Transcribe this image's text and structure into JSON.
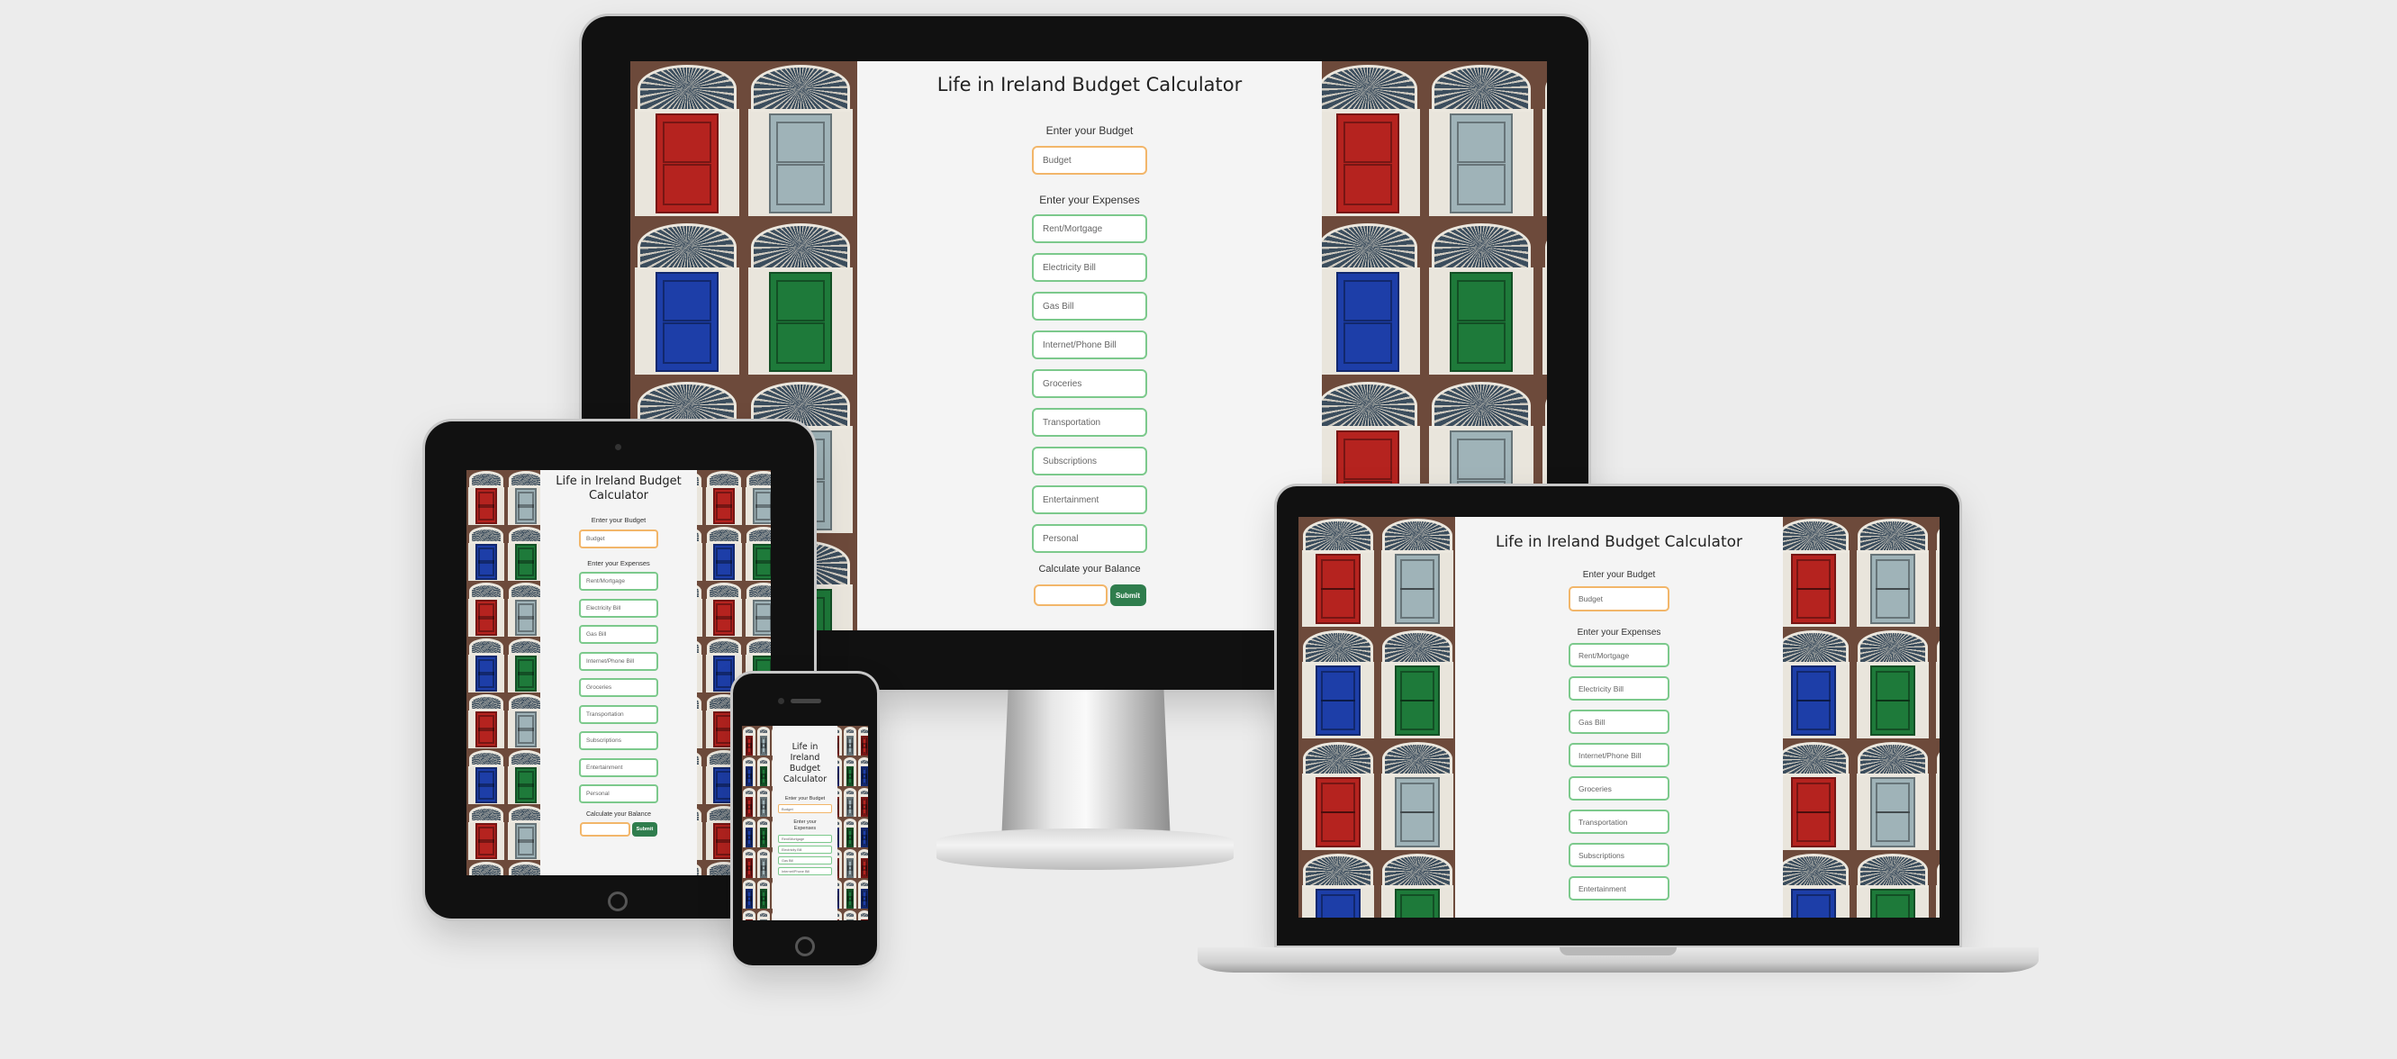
{
  "app": {
    "title": "Life in Ireland Budget Calculator",
    "budget_heading": "Enter your Budget",
    "budget_placeholder": "Budget",
    "expenses_heading": "Enter your Expenses",
    "expenses": [
      "Rent/Mortgage",
      "Electricity Bill",
      "Gas Bill",
      "Internet/Phone Bill",
      "Groceries",
      "Transportation",
      "Subscriptions",
      "Entertainment",
      "Personal"
    ],
    "balance_heading": "Calculate your Balance",
    "submit_label": "Submit"
  },
  "colors": {
    "field_border": "#7cc98c",
    "budget_border": "#f2b66a",
    "submit_bg": "#2f7d4d",
    "panel_bg": "#f4f4f4"
  },
  "devices": [
    "desktop",
    "tablet",
    "phone",
    "laptop"
  ],
  "icons": [
    "webcam-icon",
    "home-button-icon",
    "earpiece-icon"
  ]
}
